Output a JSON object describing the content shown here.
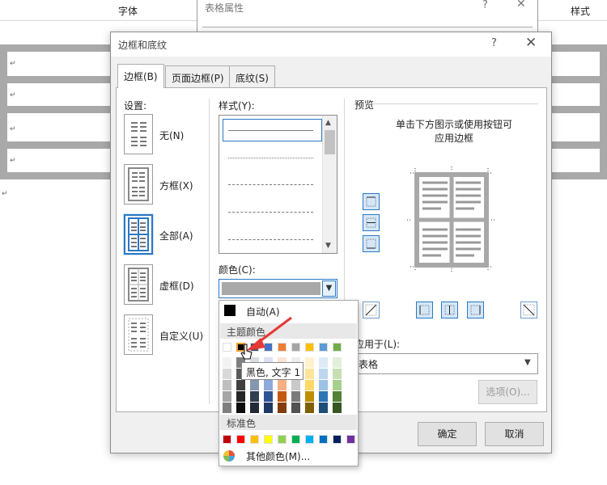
{
  "background": {
    "ribbon_left_label": "字体",
    "ribbon_right_label": "样式",
    "para_mark": "↵",
    "table_properties_title": "表格属性",
    "table_properties_help": "?",
    "table_properties_close": "✕"
  },
  "dialog": {
    "title": "边框和底纹",
    "help": "?",
    "close": "✕",
    "tabs": [
      {
        "label": "边框(B)"
      },
      {
        "label": "页面边框(P)"
      },
      {
        "label": "底纹(S)"
      }
    ],
    "active_tab": 0,
    "settings": {
      "heading": "设置:",
      "options": [
        {
          "label": "无(N)"
        },
        {
          "label": "方框(X)"
        },
        {
          "label": "全部(A)"
        },
        {
          "label": "虚框(D)"
        },
        {
          "label": "自定义(U)"
        }
      ],
      "selected_index": 2
    },
    "style": {
      "heading": "样式(Y):",
      "lines": [
        "solid",
        "dotted",
        "dash-dot",
        "dash",
        "long-dash"
      ],
      "selected_index": 0
    },
    "color": {
      "heading": "颜色(C):",
      "value_hex": "#a8a8a8"
    },
    "preview": {
      "heading": "预览",
      "hint_line1": "单击下方图示或使用按钮可",
      "hint_line2": "应用边框"
    },
    "apply_to": {
      "label": "应用于(L):",
      "value": "表格"
    },
    "options_button": "选项(O)...",
    "ok_button": "确定",
    "cancel_button": "取消"
  },
  "color_popup": {
    "auto_label": "自动(A)",
    "theme_header": "主题颜色",
    "standard_header": "标准色",
    "more_colors": "其他颜色(M)...",
    "tooltip": "黑色, 文字 1",
    "theme_colors": [
      "#ffffff",
      "#000000",
      "#44546a",
      "#4472c4",
      "#ed7d31",
      "#a5a5a5",
      "#ffc000",
      "#5b9bd5",
      "#70ad47"
    ],
    "theme_shades": [
      [
        "#f2f2f2",
        "#7f7f7f",
        "#d6dce4",
        "#d9e2f3",
        "#fbe4d5",
        "#ededed",
        "#fff2cc",
        "#deeaf6",
        "#e2efd9"
      ],
      [
        "#d9d9d9",
        "#595959",
        "#adb9ca",
        "#b4c6e7",
        "#f7caac",
        "#dbdbdb",
        "#ffe599",
        "#bdd6ee",
        "#c5e0b3"
      ],
      [
        "#bfbfbf",
        "#404040",
        "#8496b0",
        "#8eaadb",
        "#f4b083",
        "#c9c9c9",
        "#ffd965",
        "#9cc2e5",
        "#a8d08d"
      ],
      [
        "#a6a6a6",
        "#262626",
        "#323e4f",
        "#2f5496",
        "#c45911",
        "#7b7b7b",
        "#bf8f00",
        "#2e75b5",
        "#538135"
      ],
      [
        "#7f7f7f",
        "#0d0d0d",
        "#222a35",
        "#1f3864",
        "#833c0b",
        "#525252",
        "#7f6000",
        "#1f4e79",
        "#375623"
      ]
    ],
    "standard_colors": [
      "#c00000",
      "#ff0000",
      "#ffc000",
      "#ffff00",
      "#92d050",
      "#00b050",
      "#00b0f0",
      "#0070c0",
      "#002060",
      "#7030a0"
    ],
    "selected_theme_index": 1
  }
}
